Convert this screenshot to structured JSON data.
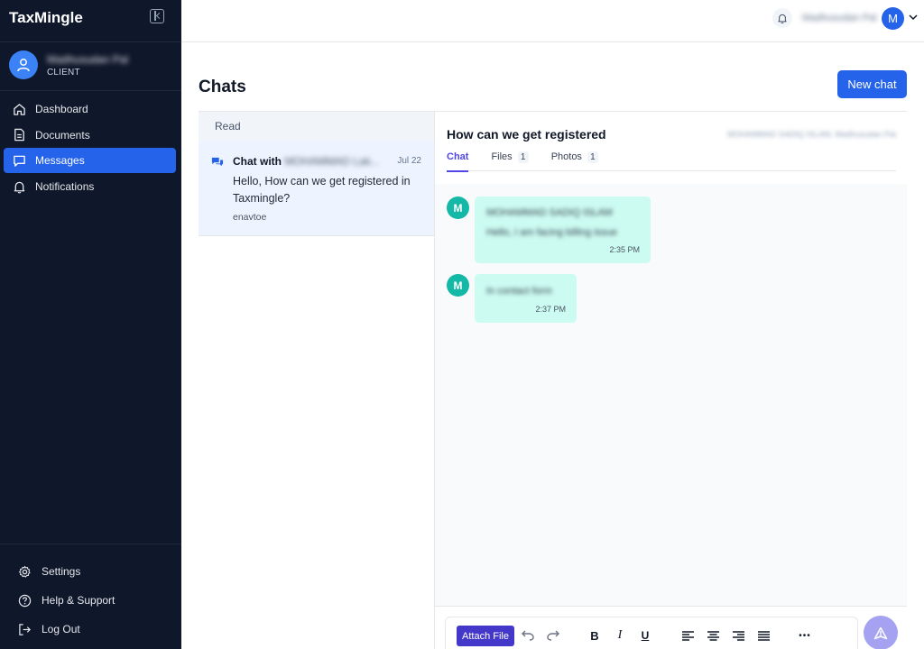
{
  "app": {
    "brand": "TaxMingle"
  },
  "user": {
    "name": "Madhusudan Pal",
    "role": "CLIENT",
    "initial": "M"
  },
  "nav": {
    "items": [
      {
        "label": "Dashboard",
        "icon": "home-icon"
      },
      {
        "label": "Documents",
        "icon": "document-icon"
      },
      {
        "label": "Messages",
        "icon": "chat-icon",
        "active": true
      },
      {
        "label": "Notifications",
        "icon": "bell-icon"
      }
    ]
  },
  "bottom_nav": {
    "settings": "Settings",
    "help": "Help & Support",
    "logout": "Log Out"
  },
  "topbar": {
    "username": "Madhusudan Pal",
    "avatar_initial": "M"
  },
  "page": {
    "title": "Chats",
    "new_chat_label": "New chat"
  },
  "chat_list": {
    "section_label": "Read",
    "items": [
      {
        "title_prefix": "Chat with",
        "title_blurred": "MOHAMMAD Lak...",
        "date": "Jul 22",
        "message": "Hello, How can we get registered in Taxmingle?",
        "tag": "enavtoe"
      }
    ]
  },
  "chat": {
    "title": "How can we get registered",
    "meta": "MOHAMMAD SADIQ ISLAM, Madhusudan Pal",
    "tabs": [
      {
        "label": "Chat",
        "count": ""
      },
      {
        "label": "Files",
        "count": "1"
      },
      {
        "label": "Photos",
        "count": "1"
      }
    ],
    "messages": [
      {
        "avatar": "M",
        "lines": [
          "MOHAMMAD SADIQ ISLAM",
          "Hello, I am facing billing issue"
        ],
        "time": "2:35 PM"
      },
      {
        "avatar": "M",
        "lines": [
          "In contact form"
        ],
        "time": "2:37 PM"
      }
    ]
  },
  "composer": {
    "attach_label": "Attach File",
    "bold": "B",
    "italic": "I",
    "underline": "U",
    "more": "•••"
  },
  "colors": {
    "sidebar_bg": "#0f172a",
    "accent": "#2563eb",
    "tab_accent": "#4f46e5",
    "bubble_bg": "#ccfbf1",
    "avatar_teal": "#14b8a6"
  }
}
